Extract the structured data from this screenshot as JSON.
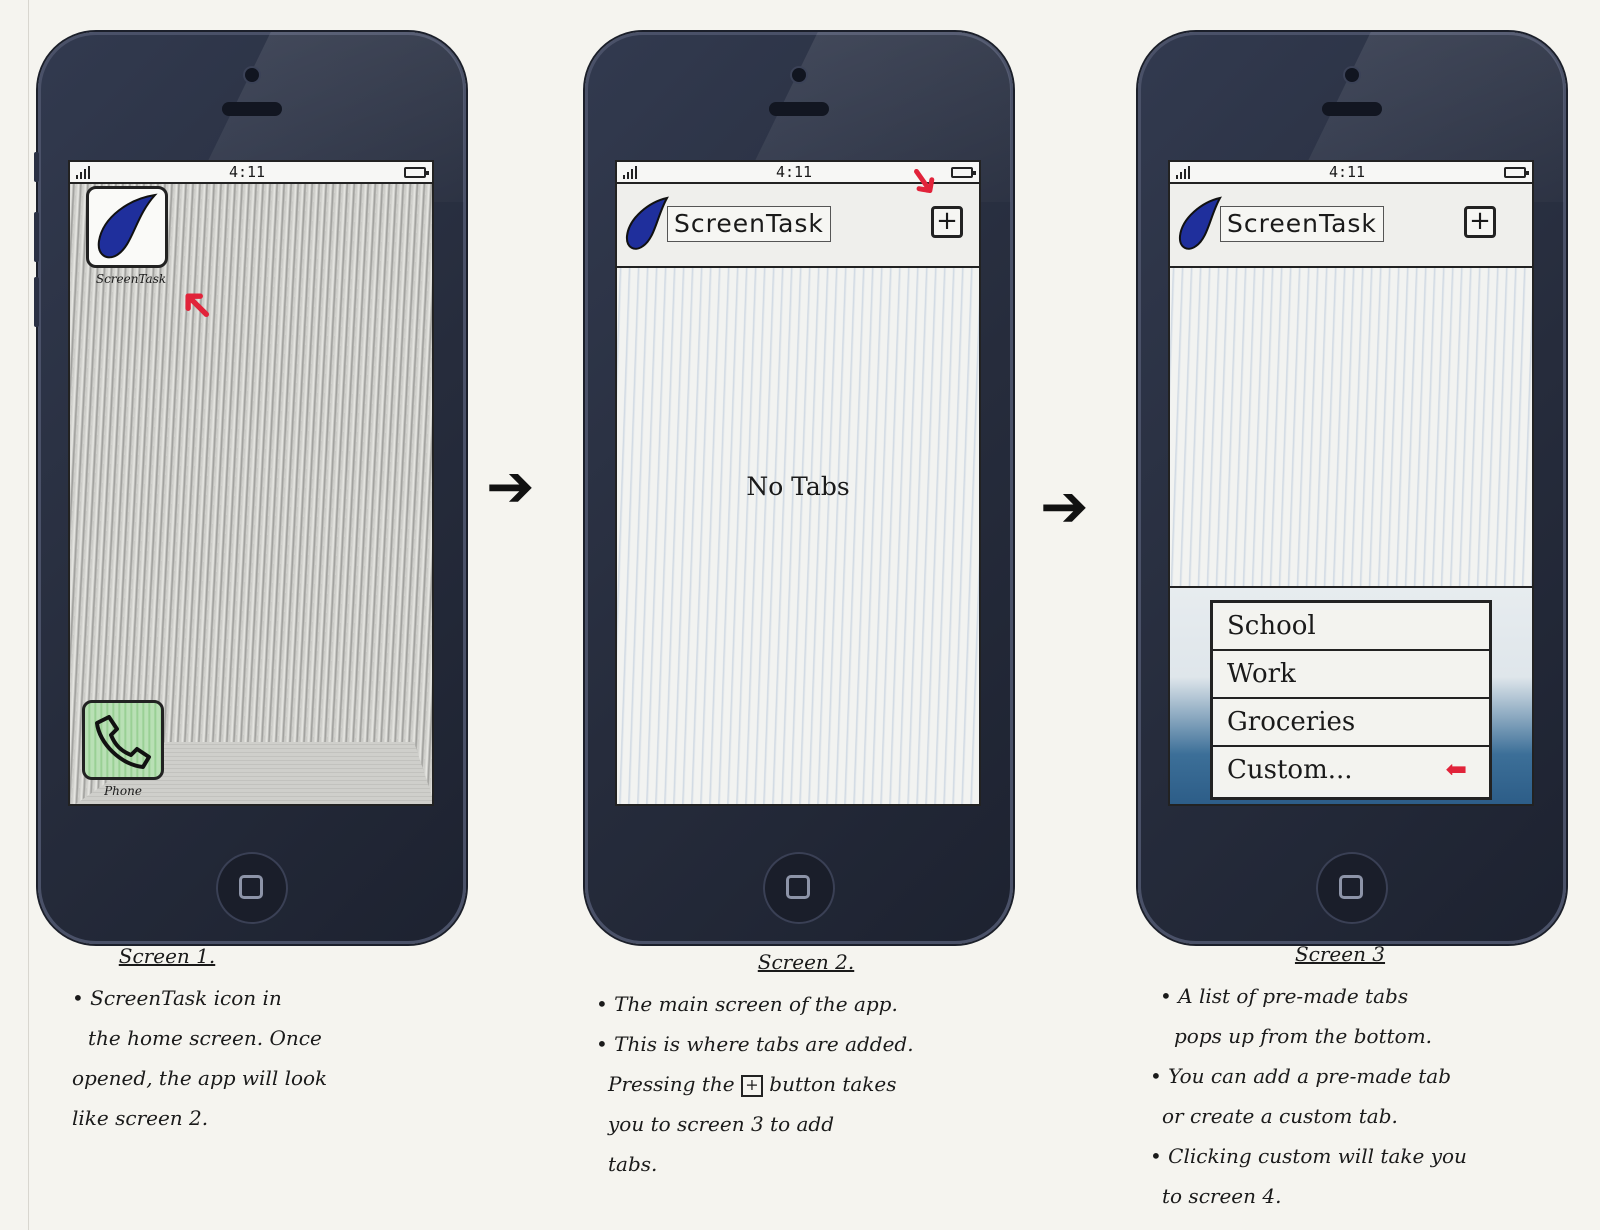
{
  "screens": [
    {
      "status_time": "4:11",
      "app_icon_label": "ScreenTask",
      "dock_icon_label": "Phone",
      "caption_title": "Screen 1.",
      "caption_lines": [
        "• ScreenTask icon in",
        "the home screen. Once",
        "opened, the app will look",
        "like screen 2."
      ]
    },
    {
      "status_time": "4:11",
      "nav_title": "ScreenTask",
      "nav_add": "+",
      "empty_message": "No Tabs",
      "caption_title": "Screen 2.",
      "caption_lines": [
        "• The main screen of the app.",
        "• This is where tabs are added.",
        "Pressing the",
        "button takes",
        "you to screen 3 to add",
        "tabs."
      ]
    },
    {
      "status_time": "4:11",
      "nav_title": "ScreenTask",
      "nav_add": "+",
      "tabs": [
        "School",
        "Work",
        "Groceries",
        "Custom..."
      ],
      "caption_title": "Screen 3",
      "caption_lines": [
        "• A list of pre-made tabs",
        "pops up from the bottom.",
        "• You can add a pre-made tab",
        "or create a custom tab.",
        "• Clicking custom will take you",
        "to screen 4."
      ]
    }
  ],
  "colors": {
    "accent_red": "#e1233a",
    "logo_blue": "#1f2f9c",
    "phone_body": "#2a3043"
  },
  "icons": {
    "flow_arrow": "right-arrow-icon",
    "highlight_arrow": "red-arrow-icon"
  }
}
